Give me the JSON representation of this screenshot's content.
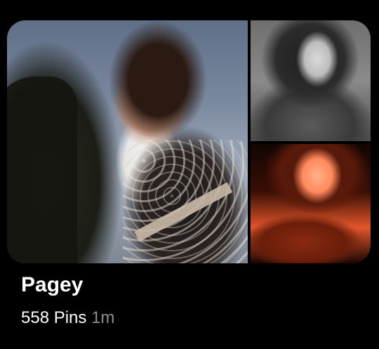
{
  "board": {
    "title": "Pagey",
    "pin_count": "558 Pins",
    "updated": "1m"
  },
  "images": [
    {
      "name": "collage-main-photo"
    },
    {
      "name": "collage-top-right-photo"
    },
    {
      "name": "collage-bottom-right-photo"
    }
  ],
  "colors": {
    "background": "#000000",
    "title": "#ffffff",
    "meta": "#ffffff",
    "time": "#8e8e8e"
  }
}
